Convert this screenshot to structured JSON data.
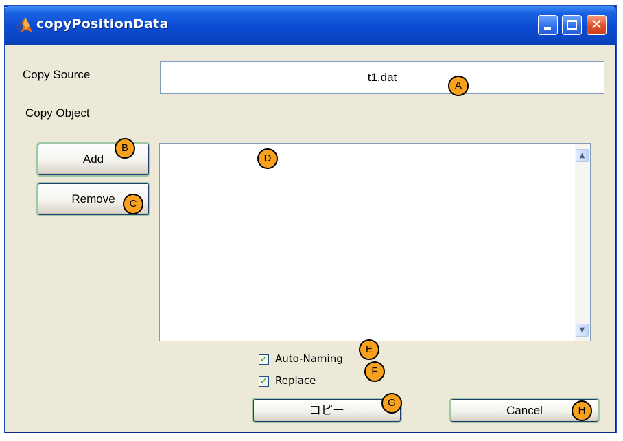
{
  "window": {
    "title": "copyPositionData"
  },
  "labels": {
    "copy_source": "Copy Source",
    "copy_object": "Copy Object"
  },
  "source_field": {
    "value": "t1.dat"
  },
  "buttons": {
    "add": "Add",
    "remove": "Remove",
    "copy": "コピー",
    "cancel": "Cancel"
  },
  "options": [
    {
      "label": "Auto-Naming",
      "checked": true
    },
    {
      "label": "Replace",
      "checked": true
    }
  ],
  "markers": [
    "A",
    "B",
    "C",
    "D",
    "E",
    "F",
    "G",
    "H"
  ],
  "icons": {
    "app": "matlab-icon",
    "minimize": "minimize-icon",
    "maximize": "maximize-icon",
    "close": "close-icon",
    "scroll_up": "scroll-up-icon",
    "scroll_down": "scroll-down-icon",
    "check": "checkmark-icon"
  },
  "colors": {
    "titlebar": "#0b4bd2",
    "window_bg": "#ece9d8",
    "marker": "#f7a11e",
    "close_button": "#e0502a"
  }
}
